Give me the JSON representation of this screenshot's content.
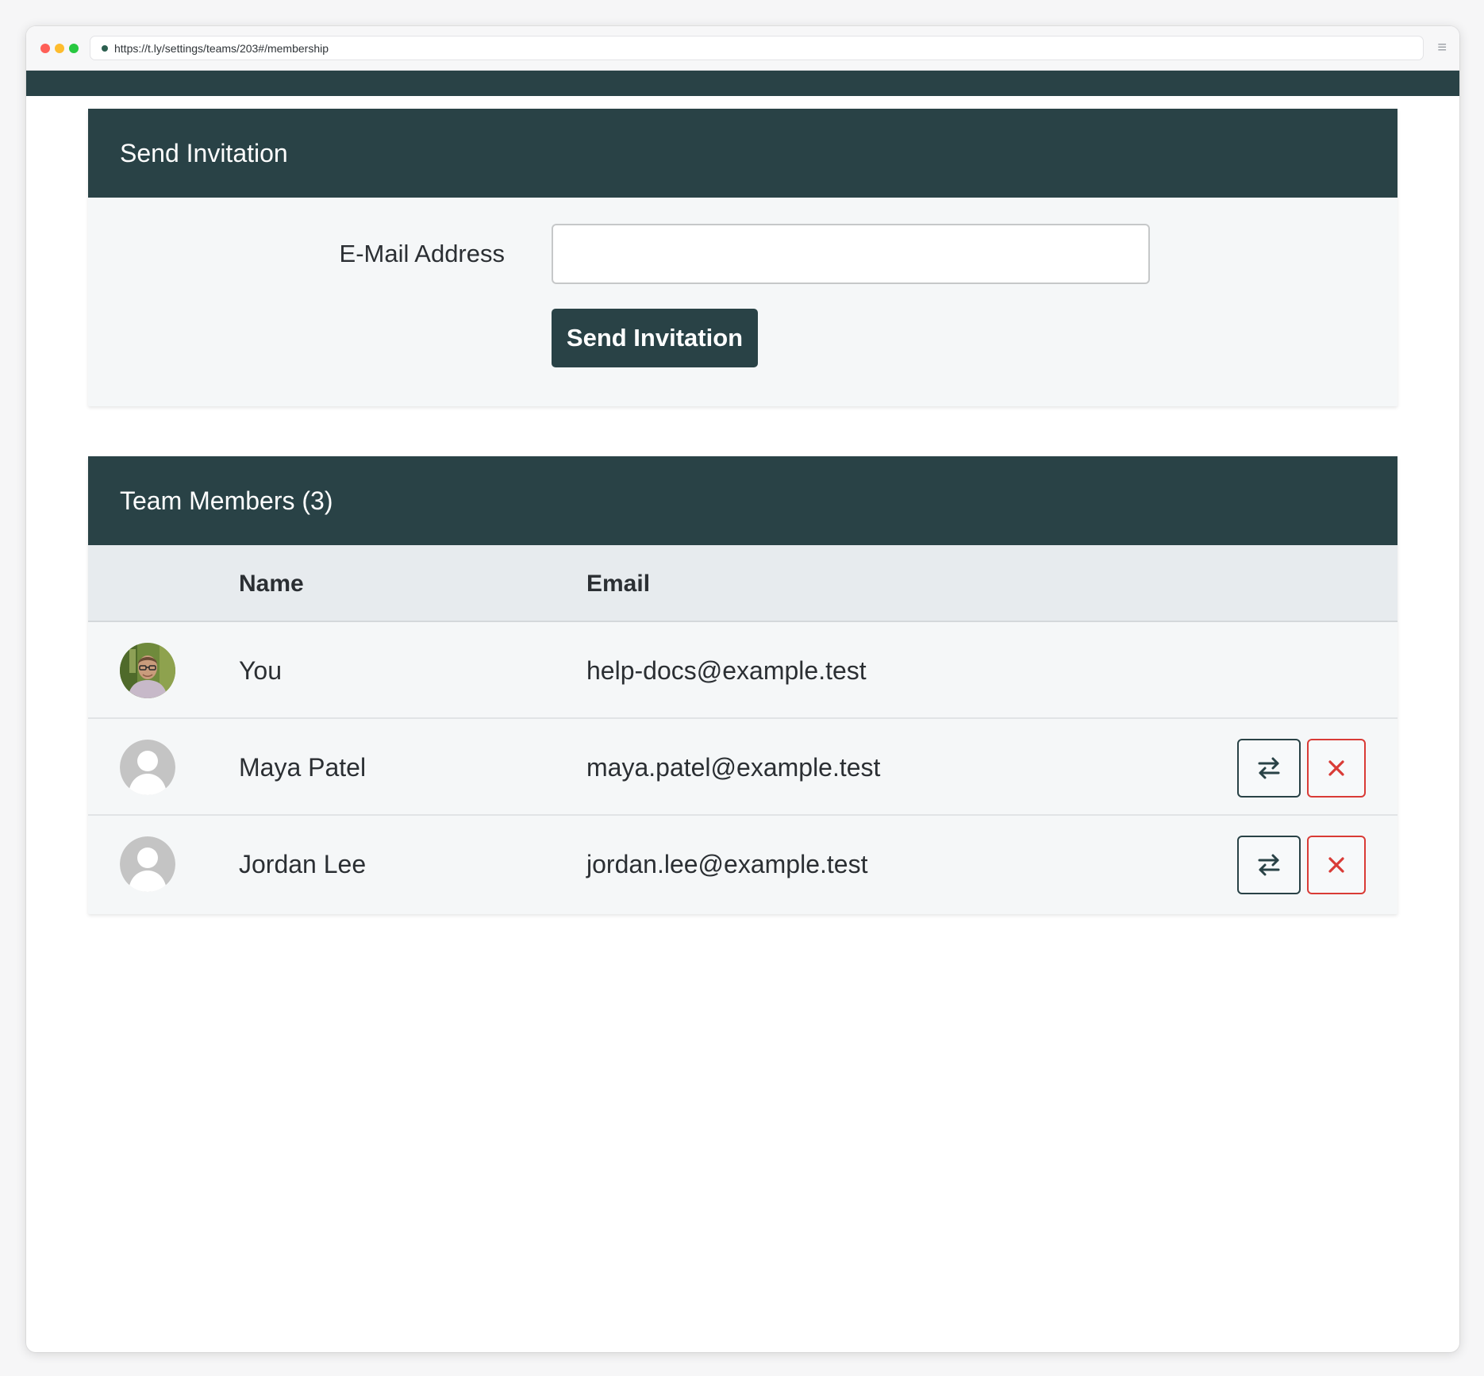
{
  "browser": {
    "url": "https://t.ly/settings/teams/203#/membership",
    "menu_glyph": "≡"
  },
  "colors": {
    "primary": "#294246",
    "danger": "#d93b36",
    "secure": "#2c5f4f",
    "traffic_red": "#ff5f57",
    "traffic_yellow": "#febc2e",
    "traffic_green": "#28c840"
  },
  "invite": {
    "title": "Send Invitation",
    "email_label": "E-Mail Address",
    "email_value": "",
    "button_label": "Send Invitation"
  },
  "members": {
    "title": "Team Members (3)",
    "columns": {
      "name": "Name",
      "email": "Email"
    },
    "rows": [
      {
        "name": "You",
        "email": "help-docs@example.test",
        "avatar": "photo",
        "actions": false
      },
      {
        "name": "Maya Patel",
        "email": "maya.patel@example.test",
        "avatar": "default-user-icon",
        "actions": true
      },
      {
        "name": "Jordan Lee",
        "email": "jordan.lee@example.test",
        "avatar": "default-user-icon",
        "actions": true
      }
    ],
    "action_icons": {
      "change_role": "swap-arrows-icon",
      "remove": "close-x-icon"
    }
  }
}
